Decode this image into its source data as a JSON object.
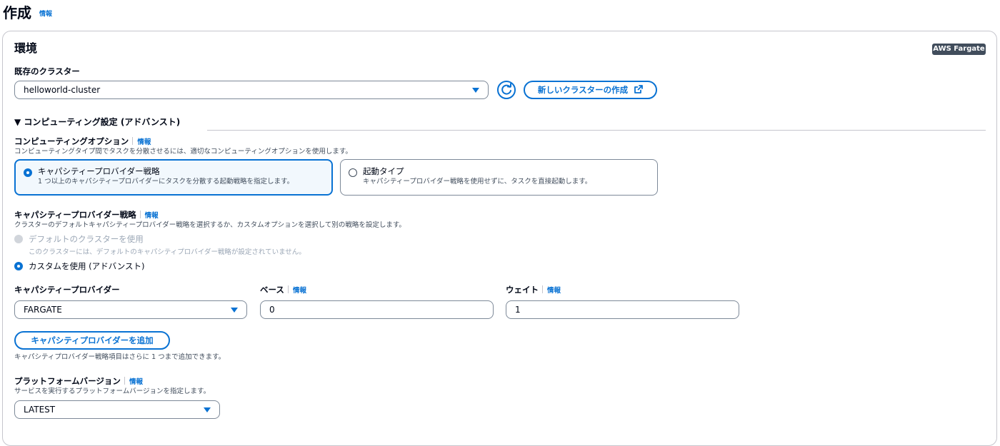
{
  "page": {
    "title": "作成",
    "info": "情報"
  },
  "env": {
    "title": "環境",
    "badge": "AWS Fargate",
    "cluster_label": "既存のクラスター",
    "cluster_value": "helloworld-cluster",
    "new_cluster_label": "新しいクラスターの作成"
  },
  "compute": {
    "toggle_label": "▼ コンピューティング設定 (アドバンスト)",
    "option_label": "コンピューティングオプション",
    "option_info": "情報",
    "option_desc": "コンピューティングタイプ間でタスクを分散させるには、適切なコンピューティングオプションを使用します。",
    "tiles": [
      {
        "title": "キャパシティープロバイダー戦略",
        "desc": "1 つ以上のキャパシティープロバイダーにタスクを分散する起動戦略を指定します。",
        "selected": true
      },
      {
        "title": "起動タイプ",
        "desc": "キャパシティープロバイダー戦略を使用せずに、タスクを直接起動します。",
        "selected": false
      }
    ]
  },
  "strategy": {
    "label": "キャパシティープロバイダー戦略",
    "info": "情報",
    "desc": "クラスターのデフォルトキャパシティープロバイダー戦略を選択するか、カスタムオプションを選択して別の戦略を設定します。",
    "default_option": "デフォルトのクラスターを使用",
    "default_desc": "このクラスターには、デフォルトのキャパシティプロバイダー戦略が設定されていません。",
    "custom_option": "カスタムを使用 (アドバンスト)"
  },
  "provider": {
    "provider_label": "キャパシティープロバイダー",
    "provider_value": "FARGATE",
    "base_label": "ベース",
    "base_info": "情報",
    "base_value": "0",
    "weight_label": "ウェイト",
    "weight_info": "情報",
    "weight_value": "1",
    "add_button": "キャパシティプロバイダーを追加",
    "add_hint": "キャパシティプロバイダー戦略項目はさらに 1 つまで追加できます。"
  },
  "platform": {
    "label": "プラットフォームバージョン",
    "info": "情報",
    "desc": "サービスを実行するプラットフォームバージョンを指定します。",
    "value": "LATEST"
  },
  "colors": {
    "accent": "#0972d3",
    "badge_bg": "#414d5c",
    "tile_selected_bg": "#f2f8fd"
  },
  "icons": {
    "refresh": "refresh-icon",
    "external": "external-link-icon",
    "caret": "caret-down-icon"
  }
}
